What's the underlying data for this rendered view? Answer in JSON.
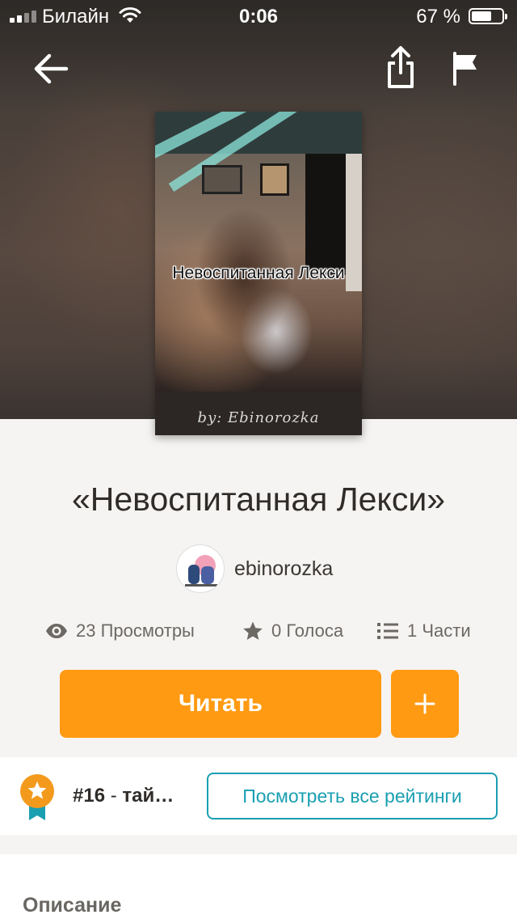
{
  "status_bar": {
    "carrier": "Билайн",
    "time": "0:06",
    "battery_percent_label": "67 %",
    "battery_level": 0.67
  },
  "nav": {
    "back_icon": "arrow-left-icon",
    "share_icon": "share-icon",
    "report_icon": "flag-icon"
  },
  "cover": {
    "title": "Невоспитанная Лекси",
    "signature": "by: Ebinorozka"
  },
  "story": {
    "title": "«Невоспитанная Лекси»",
    "author": "ebinorozka"
  },
  "stats": {
    "views": "23 Просмотры",
    "votes": "0 Голоса",
    "parts": "1 Части"
  },
  "actions": {
    "read_label": "Читать",
    "add_label": "+"
  },
  "ranking": {
    "rank": "#16",
    "separator": " - ",
    "tag": "тай…",
    "button_label": "Посмотреть все рейтинги"
  },
  "description": {
    "heading": "Описание"
  },
  "colors": {
    "accent_orange": "#ff9a12",
    "link_teal": "#1a9fb1",
    "background": "#f6f4f2"
  }
}
